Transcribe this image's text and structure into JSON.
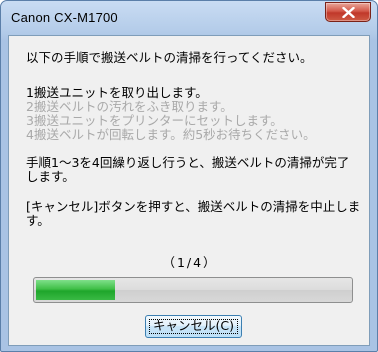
{
  "window": {
    "title": "Canon CX-M1700"
  },
  "dialog": {
    "intro": "以下の手順で搬送ベルトの清掃を行ってください。",
    "steps": [
      "1搬送ユニットを取り出します。",
      "2搬送ベルトの汚れをふき取ります。",
      "3搬送ユニットをプリンターにセットします。",
      "4搬送ベルトが回転します。約5秒お待ちください。"
    ],
    "repeat_line1": "手順1～3を4回繰り返し行うと、搬送ベルトの清掃が完了",
    "repeat_line2": "します。",
    "cancel_info_line1": "[キャンセル]ボタンを押すと、搬送ベルトの清掃を中止しま",
    "cancel_info_line2": "す。",
    "counter": "（1/4）",
    "progress_fraction": 0.25,
    "cancel_button_label": "キャンセル(C)"
  },
  "colors": {
    "progress_fill": "#3fbf47",
    "close_button": "#c0382a",
    "dimmed_step_text": "#a9a9a9"
  },
  "icons": {
    "close": "close-icon"
  }
}
